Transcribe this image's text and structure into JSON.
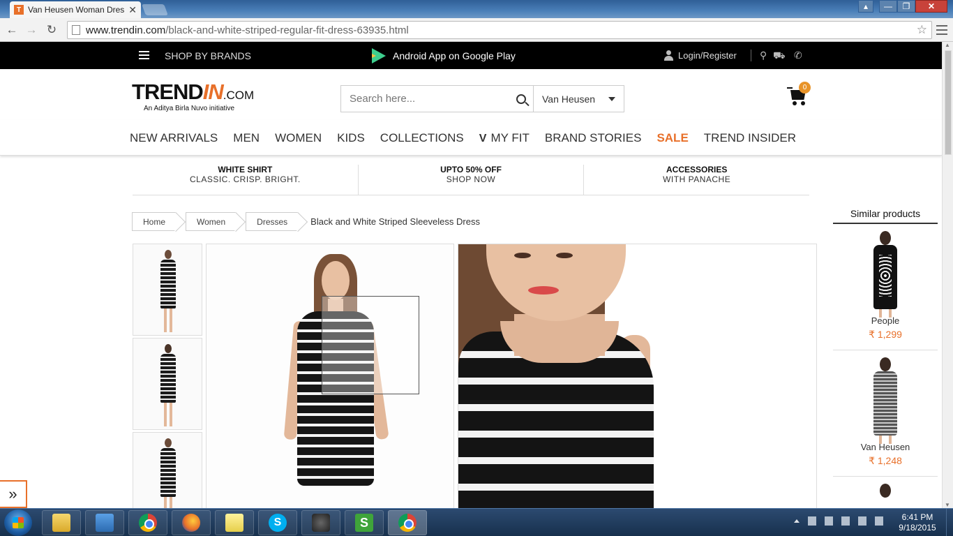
{
  "browser": {
    "tab_title": "Van Heusen Woman Dres",
    "tab_favicon": "T",
    "url_domain": "www.trendin.com",
    "url_path": "/black-and-white-striped-regular-fit-dress-63935.html"
  },
  "topbar": {
    "shop_by_brands": "SHOP BY BRANDS",
    "android_app": "Android App on Google Play",
    "login": "Login/Register"
  },
  "header": {
    "logo_main_a": "TREND",
    "logo_main_b": "IN",
    "logo_main_c": ".COM",
    "logo_tagline": "An Aditya Birla Nuvo initiative",
    "search_placeholder": "Search here...",
    "brand_selected": "Van Heusen",
    "cart_count": "0"
  },
  "nav": {
    "items": [
      "NEW ARRIVALS",
      "MEN",
      "WOMEN",
      "KIDS",
      "COLLECTIONS",
      "MY FIT",
      "BRAND STORIES",
      "SALE",
      "TREND INSIDER"
    ]
  },
  "promos": [
    {
      "heading": "WHITE SHIRT",
      "sub": "CLASSIC. CRISP. BRIGHT."
    },
    {
      "heading": "UPTO 50% OFF",
      "sub": "SHOP NOW"
    },
    {
      "heading": "ACCESSORIES",
      "sub": "WITH PANACHE"
    }
  ],
  "breadcrumb": {
    "items": [
      "Home",
      "Women",
      "Dresses"
    ],
    "current": "Black and White Striped Sleeveless Dress"
  },
  "similar": {
    "title": "Similar products",
    "items": [
      {
        "name": "People",
        "price": "₹ 1,299"
      },
      {
        "name": "Van Heusen",
        "price": "₹ 1,248"
      }
    ]
  },
  "taskbar": {
    "time": "6:41 PM",
    "date": "9/18/2015"
  },
  "colors": {
    "accent": "#e8702a",
    "topbar_bg": "#000000"
  }
}
